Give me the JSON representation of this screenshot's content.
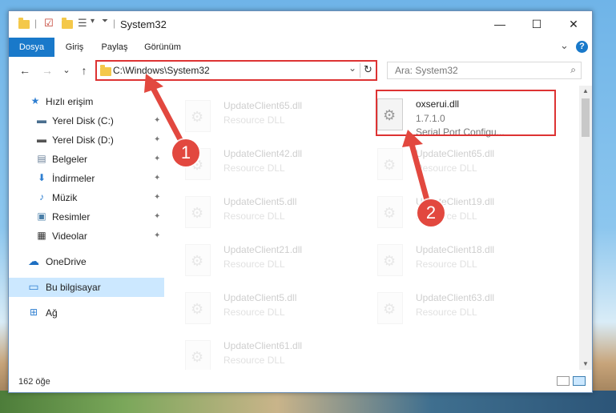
{
  "window": {
    "title": "System32",
    "minimize_glyph": "—",
    "maximize_glyph": "☐",
    "close_glyph": "✕"
  },
  "ribbon": {
    "tabs": [
      {
        "label": "Dosya",
        "active": true
      },
      {
        "label": "Giriş",
        "active": false
      },
      {
        "label": "Paylaş",
        "active": false
      },
      {
        "label": "Görünüm",
        "active": false
      }
    ],
    "expand_glyph": "⌄",
    "help_glyph": "?"
  },
  "nav": {
    "back_glyph": "←",
    "forward_glyph": "→",
    "recent_glyph": "⌄",
    "up_glyph": "↑",
    "address": "C:\\Windows\\System32",
    "dropdown_glyph": "⌄",
    "refresh_glyph": "↻",
    "search_placeholder": "Ara: System32",
    "search_glyph": "⌕"
  },
  "sidebar": {
    "items": [
      {
        "label": "Hızlı erişim",
        "icon": "star-icon",
        "glyph": "★",
        "color": "#2f7fd1",
        "pinned": false
      },
      {
        "label": "Yerel Disk (C:)",
        "icon": "drive-icon",
        "glyph": "▬",
        "color": "#4a6f8f",
        "pinned": true
      },
      {
        "label": "Yerel Disk (D:)",
        "icon": "drive-icon",
        "glyph": "▬",
        "color": "#555555",
        "pinned": true
      },
      {
        "label": "Belgeler",
        "icon": "documents-icon",
        "glyph": "▤",
        "color": "#6a7f98",
        "pinned": true
      },
      {
        "label": "İndirmeler",
        "icon": "download-icon",
        "glyph": "⬇",
        "color": "#2f7fd1",
        "pinned": true
      },
      {
        "label": "Müzik",
        "icon": "music-icon",
        "glyph": "♪",
        "color": "#2f7fd1",
        "pinned": true
      },
      {
        "label": "Resimler",
        "icon": "pictures-icon",
        "glyph": "▣",
        "color": "#4a7fa8",
        "pinned": true
      },
      {
        "label": "Videolar",
        "icon": "video-icon",
        "glyph": "▦",
        "color": "#333333",
        "pinned": true
      },
      {
        "label": "OneDrive",
        "icon": "cloud-icon",
        "glyph": "☁",
        "color": "#1e6fc2",
        "pinned": false
      },
      {
        "label": "Bu bilgisayar",
        "icon": "computer-icon",
        "glyph": "▭",
        "color": "#2f7fd1",
        "pinned": false,
        "selected": true
      },
      {
        "label": "Ağ",
        "icon": "network-icon",
        "glyph": "⊞",
        "color": "#2f7fd1",
        "pinned": false
      }
    ],
    "pin_glyph": "📌"
  },
  "files": {
    "left_column": [
      {
        "name": "UpdateClient65.dll",
        "type": "Resource DLL"
      },
      {
        "name": "UpdateClient42.dll",
        "type": "Resource DLL"
      },
      {
        "name": "UpdateClient5.dll",
        "type": "Resource DLL"
      },
      {
        "name": "UpdateClient21.dll",
        "type": "Resource DLL"
      },
      {
        "name": "UpdateClient5.dll",
        "type": "Resource DLL"
      },
      {
        "name": "UpdateClient61.dll",
        "type": "Resource DLL"
      }
    ],
    "right_column": [
      {
        "name": "oxserui.dll",
        "version": "1.7.1.0",
        "description": "Serial Port Configu...",
        "highlighted": true
      },
      {
        "name": "UpdateClient65.dll",
        "type": "Resource DLL"
      },
      {
        "name": "UpdateClient19.dll",
        "type": "Resource DLL"
      },
      {
        "name": "UpdateClient18.dll",
        "type": "Resource DLL"
      },
      {
        "name": "UpdateClient63.dll",
        "type": "Resource DLL"
      }
    ]
  },
  "status": {
    "count": "162 öğe"
  },
  "annotations": {
    "callout_1": "1",
    "callout_2": "2",
    "color": "#e2483f"
  }
}
